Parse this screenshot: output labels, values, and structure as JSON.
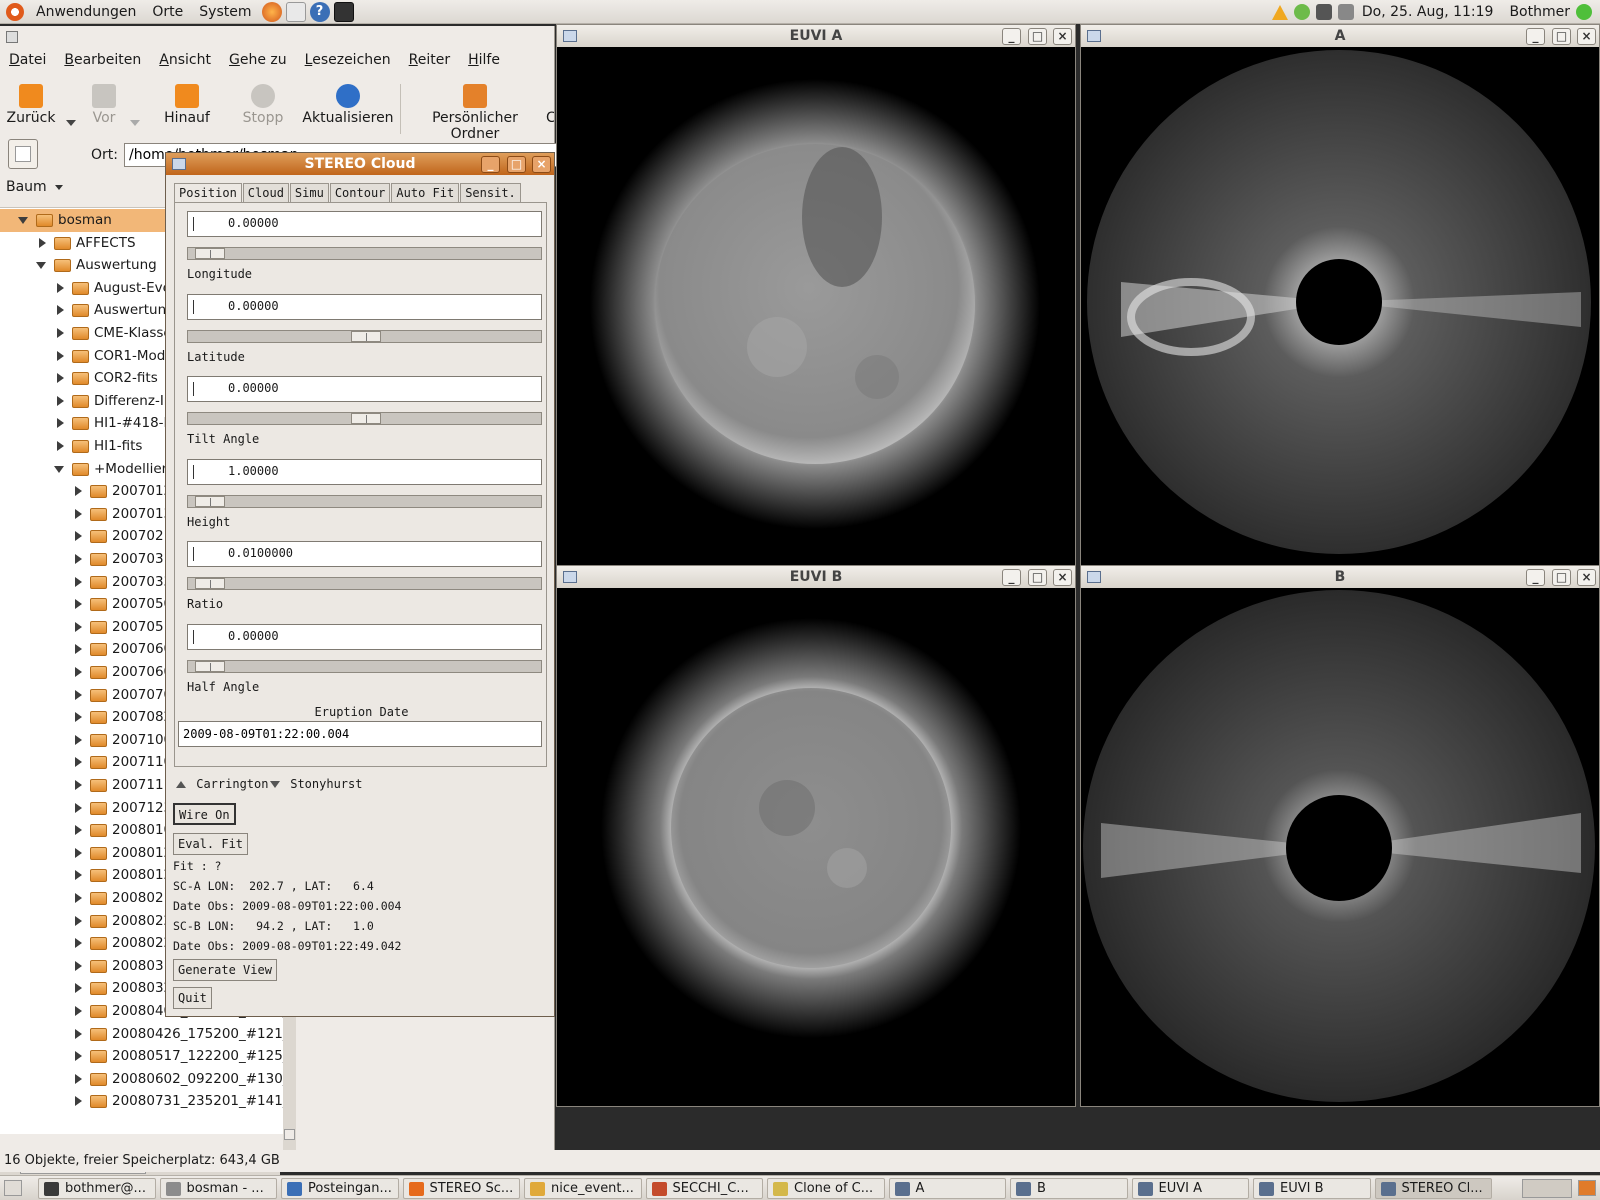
{
  "top_panel": {
    "menus": [
      "Anwendungen",
      "Orte",
      "System"
    ],
    "clock": "Do, 25. Aug, 11:19",
    "user": "Bothmer"
  },
  "file_manager": {
    "menus": [
      "Datei",
      "Bearbeiten",
      "Ansicht",
      "Gehe zu",
      "Lesezeichen",
      "Reiter",
      "Hilfe"
    ],
    "toolbar": {
      "back": "Zurück",
      "forward": "Vor",
      "up": "Hinauf",
      "stop": "Stopp",
      "reload": "Aktualisieren",
      "home": "Persönlicher Ordner",
      "extra": "C"
    },
    "location_label": "Ort:",
    "location_value": "/home/bothmer/bosman",
    "side_header": "Baum",
    "tree": [
      {
        "label": "bosman",
        "level": 0,
        "state": "open",
        "selected": true
      },
      {
        "label": "AFFECTS",
        "level": 1,
        "state": "closed"
      },
      {
        "label": "Auswertung",
        "level": 1,
        "state": "open"
      },
      {
        "label": "August-Eve",
        "level": 2,
        "state": "closed"
      },
      {
        "label": "Auswertung",
        "level": 2,
        "state": "closed"
      },
      {
        "label": "CME-Klasse",
        "level": 2,
        "state": "closed"
      },
      {
        "label": "COR1-Mode",
        "level": 2,
        "state": "closed"
      },
      {
        "label": "COR2-fits",
        "level": 2,
        "state": "closed"
      },
      {
        "label": "Differenz-Ir",
        "level": 2,
        "state": "closed"
      },
      {
        "label": "HI1-#418-F",
        "level": 2,
        "state": "closed"
      },
      {
        "label": "HI1-fits",
        "level": 2,
        "state": "closed"
      },
      {
        "label": "+Modellier",
        "level": 2,
        "state": "open"
      },
      {
        "label": "2007012",
        "level": 3,
        "state": "closed"
      },
      {
        "label": "2007013",
        "level": 3,
        "state": "closed"
      },
      {
        "label": "2007021",
        "level": 3,
        "state": "closed"
      },
      {
        "label": "2007031",
        "level": 3,
        "state": "closed"
      },
      {
        "label": "2007033",
        "level": 3,
        "state": "closed"
      },
      {
        "label": "2007050",
        "level": 3,
        "state": "closed"
      },
      {
        "label": "2007051",
        "level": 3,
        "state": "closed"
      },
      {
        "label": "2007060",
        "level": 3,
        "state": "closed"
      },
      {
        "label": "2007060",
        "level": 3,
        "state": "closed"
      },
      {
        "label": "2007070",
        "level": 3,
        "state": "closed"
      },
      {
        "label": "2007082",
        "level": 3,
        "state": "closed"
      },
      {
        "label": "2007100",
        "level": 3,
        "state": "closed"
      },
      {
        "label": "2007110",
        "level": 3,
        "state": "closed"
      },
      {
        "label": "2007111",
        "level": 3,
        "state": "closed"
      },
      {
        "label": "2007123",
        "level": 3,
        "state": "closed"
      },
      {
        "label": "2008010",
        "level": 3,
        "state": "closed"
      },
      {
        "label": "2008012",
        "level": 3,
        "state": "closed"
      },
      {
        "label": "2008012",
        "level": 3,
        "state": "closed"
      },
      {
        "label": "2008021",
        "level": 3,
        "state": "closed"
      },
      {
        "label": "2008022",
        "level": 3,
        "state": "closed"
      },
      {
        "label": "2008022",
        "level": 3,
        "state": "closed"
      },
      {
        "label": "2008031",
        "level": 3,
        "state": "closed"
      },
      {
        "label": "2008032",
        "level": 3,
        "state": "closed"
      },
      {
        "label": "20080405_175220_#113_",
        "level": 3,
        "state": "closed"
      },
      {
        "label": "20080426_175200_#121_",
        "level": 3,
        "state": "closed"
      },
      {
        "label": "20080517_122200_#125_",
        "level": 3,
        "state": "closed"
      },
      {
        "label": "20080602_092200_#130_",
        "level": 3,
        "state": "closed"
      },
      {
        "label": "20080731_235201_#141_",
        "level": 3,
        "state": "closed"
      }
    ],
    "status": "16 Objekte, freier Speicherplatz: 643,4 GB"
  },
  "image_windows": {
    "euvi_a": {
      "title": "EUVI A"
    },
    "cor_a": {
      "title": "A"
    },
    "euvi_b": {
      "title": "EUVI B"
    },
    "cor_b": {
      "title": "B"
    }
  },
  "stereo_dialog": {
    "title": "STEREO Cloud",
    "tabs": [
      "Position",
      "Cloud",
      "Simu",
      "Contour",
      "Auto Fit",
      "Sensit."
    ],
    "fields": [
      {
        "label": "Longitude",
        "value": "0.00000",
        "slider_fraction": 0.02
      },
      {
        "label": "Latitude",
        "value": "0.00000",
        "slider_fraction": 0.5
      },
      {
        "label": "Tilt Angle",
        "value": "0.00000",
        "slider_fraction": 0.5
      },
      {
        "label": "Height",
        "value": "1.00000",
        "slider_fraction": 0.02
      },
      {
        "label": "Ratio",
        "value": "0.0100000",
        "slider_fraction": 0.02
      },
      {
        "label": "Half Angle",
        "value": "0.00000",
        "slider_fraction": 0.02
      }
    ],
    "eruption_date_label": "Eruption Date",
    "eruption_date_value": "2009-08-09T01:22:00.004",
    "radio_carrington": "Carrington",
    "radio_stonyhurst": "Stonyhurst",
    "wire_button": "Wire On",
    "eval_button": "Eval. Fit",
    "fit_text": "Fit : ?",
    "sc_a": "SC-A LON:  202.7 , LAT:   6.4",
    "date_obs_a": "Date Obs: 2009-08-09T01:22:00.004",
    "sc_b": "SC-B LON:   94.2 , LAT:   1.0",
    "date_obs_b": "Date Obs: 2009-08-09T01:22:49.042",
    "generate_button": "Generate View",
    "quit_button": "Quit"
  },
  "taskbar": [
    {
      "label": "bothmer@...",
      "icon_color": "#3a3a3a"
    },
    {
      "label": "bosman - ...",
      "icon_color": "#8c8c8c"
    },
    {
      "label": "Posteingan...",
      "icon_color": "#3b6fb6"
    },
    {
      "label": "STEREO Sc...",
      "icon_color": "#e66a1c"
    },
    {
      "label": "nice_event...",
      "icon_color": "#e0a93a"
    },
    {
      "label": "SECCHI_C...",
      "icon_color": "#c44b2b"
    },
    {
      "label": "Clone of C...",
      "icon_color": "#d4b84a"
    },
    {
      "label": "A",
      "icon_color": "#5a6f8e"
    },
    {
      "label": "B",
      "icon_color": "#5a6f8e"
    },
    {
      "label": "EUVI A",
      "icon_color": "#5a6f8e"
    },
    {
      "label": "EUVI B",
      "icon_color": "#5a6f8e"
    },
    {
      "label": "STEREO Cl...",
      "icon_color": "#5a6f8e",
      "active": true
    }
  ]
}
